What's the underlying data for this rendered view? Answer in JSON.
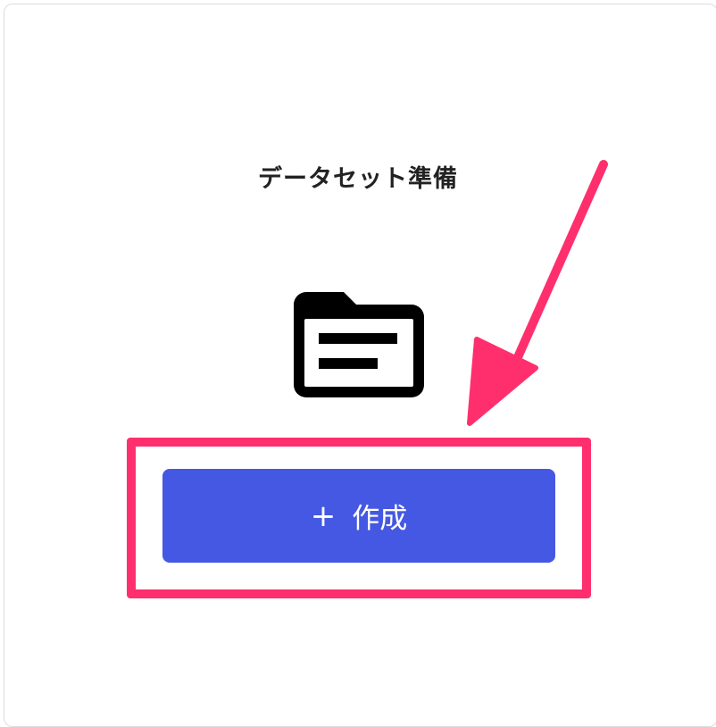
{
  "panel": {
    "title": "データセット準備",
    "icon": "folder-document-icon",
    "create_button": {
      "icon_glyph": "+",
      "icon": "plus-icon",
      "label": "作成"
    }
  },
  "annotation": {
    "highlight_color": "#ff2f6e",
    "arrow_icon": "pointer-arrow-icon"
  },
  "colors": {
    "button_bg": "#4558e3",
    "button_text": "#ffffff",
    "title_text": "#222222",
    "card_border": "#dcdce3"
  }
}
